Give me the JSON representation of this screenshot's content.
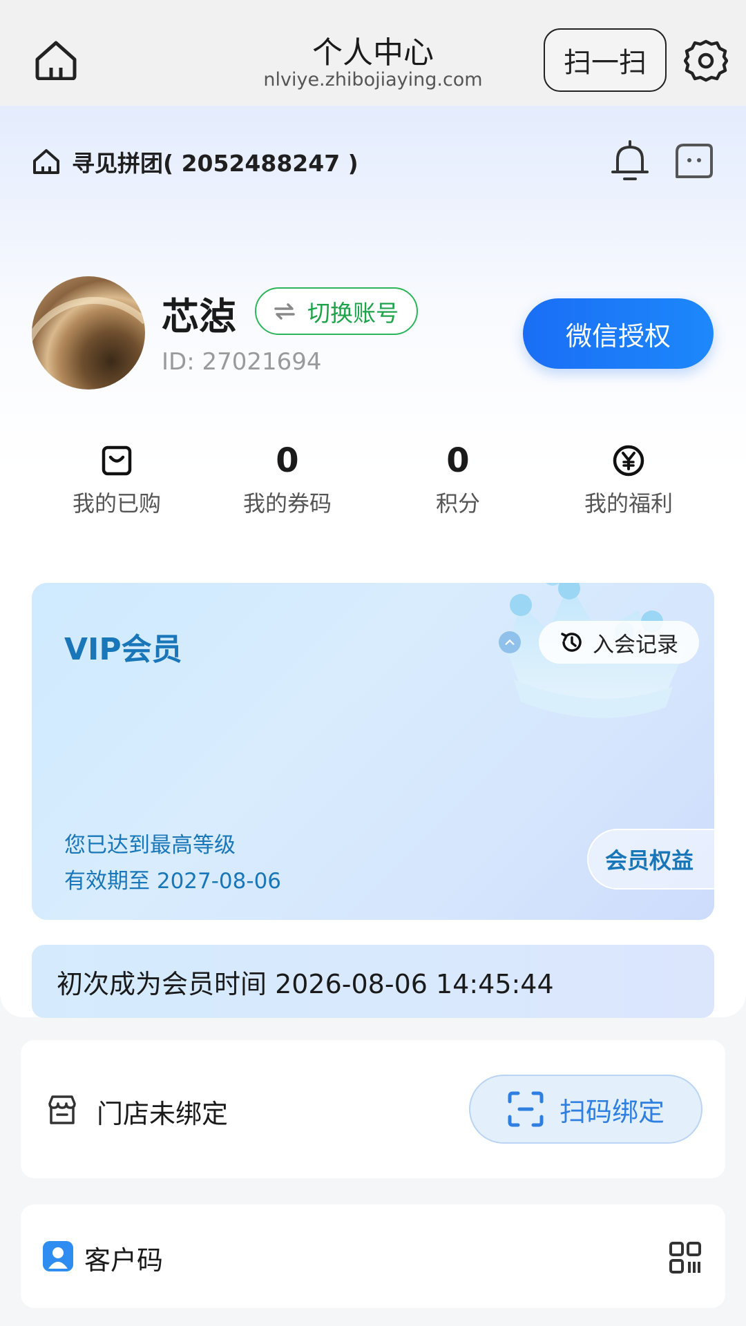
{
  "topbar": {
    "title": "个人中心",
    "subtitle": "nlviye.zhibojiaying.com",
    "scan_label": "扫一扫"
  },
  "group": {
    "name": "寻见拼团( 2052488247 )"
  },
  "profile": {
    "username": "芯惉",
    "switch_label": "切换账号",
    "id_text": "ID: 27021694",
    "wechat_label": "微信授权"
  },
  "stats": [
    {
      "value": "",
      "label": "我的已购",
      "icon": "shopping-bag-icon"
    },
    {
      "value": "0",
      "label": "我的券码"
    },
    {
      "value": "0",
      "label": "积分"
    },
    {
      "value": "",
      "label": "我的福利",
      "icon": "yen-coin-icon"
    }
  ],
  "vip": {
    "title": "VIP会员",
    "record_label": "入会记录",
    "level_text": "您已达到最高等级",
    "expire_text": "有效期至 2027-08-06",
    "benefit_label": "会员权益"
  },
  "first_member_text": "初次成为会员时间 2026-08-06 14:45:44",
  "store": {
    "status_text": "门店未绑定",
    "bind_label": "扫码绑定"
  },
  "customer_code": {
    "label": "客户码"
  },
  "colors": {
    "accent_blue": "#1a6ef5",
    "switch_green": "#1ea34b",
    "vip_text": "#1976b8"
  }
}
